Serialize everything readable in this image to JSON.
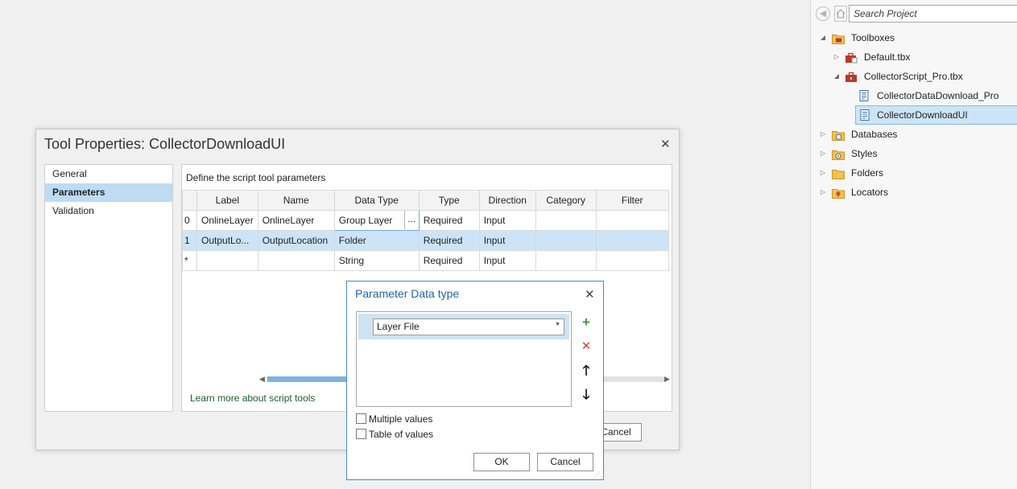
{
  "catalog": {
    "search_placeholder": "Search Project",
    "tree": [
      {
        "label": "Toolboxes",
        "icon": "toolbox-folder-icon",
        "expander": "◢"
      },
      {
        "label": "Default.tbx",
        "icon": "toolbox-icon",
        "expander": "▷"
      },
      {
        "label": "CollectorScript_Pro.tbx",
        "icon": "toolbox-icon",
        "expander": "◢"
      },
      {
        "label": "CollectorDataDownload_Pro",
        "icon": "script-icon"
      },
      {
        "label": "CollectorDownloadUI",
        "icon": "script-icon",
        "selected": true
      },
      {
        "label": "Databases",
        "icon": "database-folder-icon",
        "expander": "▷"
      },
      {
        "label": "Styles",
        "icon": "styles-folder-icon",
        "expander": "▷"
      },
      {
        "label": "Folders",
        "icon": "folder-icon",
        "expander": "▷"
      },
      {
        "label": "Locators",
        "icon": "locator-folder-icon",
        "expander": "▷"
      }
    ]
  },
  "tool_properties": {
    "title": "Tool Properties: CollectorDownloadUI",
    "nav": [
      "General",
      "Parameters",
      "Validation"
    ],
    "selected_nav": "Parameters",
    "description": "Define the script tool parameters",
    "columns": [
      "Label",
      "Name",
      "Data Type",
      "Type",
      "Direction",
      "Category",
      "Filter"
    ],
    "rows": [
      {
        "idx": "0",
        "label": "OnlineLayer",
        "name": "OnlineLayer",
        "data_type": "Group Layer",
        "type": "Required",
        "direction": "Input",
        "category": "",
        "filter": ""
      },
      {
        "idx": "1",
        "label": "OutputLo...",
        "name": "OutputLocation",
        "data_type": "Folder",
        "type": "Required",
        "direction": "Input",
        "category": "",
        "filter": ""
      },
      {
        "idx": "*",
        "label": "",
        "name": "",
        "data_type": "String",
        "type": "Required",
        "direction": "Input",
        "category": "",
        "filter": ""
      }
    ],
    "ellipsis": "...",
    "learn_more": "Learn more about script tools",
    "cancel_label": "Cancel"
  },
  "data_type_dialog": {
    "title": "Parameter Data type",
    "selected_type": "Layer File",
    "multiple_values_label": "Multiple values",
    "table_of_values_label": "Table of values",
    "multiple_values_checked": false,
    "table_of_values_checked": false,
    "ok_label": "OK",
    "cancel_label": "Cancel"
  },
  "colors": {
    "accent_blue": "#1f63a8",
    "selection": "#cce4f7",
    "add_green": "#3f9a3f",
    "remove_red": "#d0482f"
  }
}
